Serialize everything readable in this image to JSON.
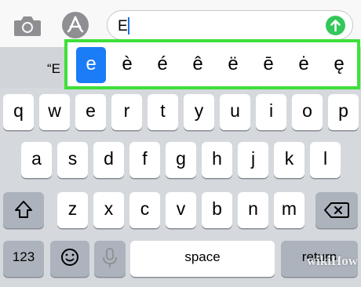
{
  "toolbar": {
    "camera_icon": "camera-icon",
    "appstore_icon": "app-store-icon",
    "message_text": "E",
    "send_icon": "arrow-up-icon"
  },
  "predictive": {
    "suggestion_text": "“E"
  },
  "accent_popup": {
    "options": [
      "e",
      "è",
      "é",
      "ê",
      "ë",
      "ē",
      "ė",
      "ę"
    ],
    "selected": "e"
  },
  "keyboard": {
    "row1": [
      "q",
      "w",
      "e",
      "r",
      "t",
      "y",
      "u",
      "i",
      "o",
      "p"
    ],
    "row2": [
      "a",
      "s",
      "d",
      "f",
      "g",
      "h",
      "j",
      "k",
      "l"
    ],
    "row3": [
      "z",
      "x",
      "c",
      "v",
      "b",
      "n",
      "m"
    ],
    "numbers_label": "123",
    "space_label": "space",
    "return_label": "return"
  },
  "watermark": "wikiHow",
  "colors": {
    "selected_accent": "#1a7cf6",
    "highlight_border": "#3ee03a",
    "send_button": "#34c759"
  }
}
